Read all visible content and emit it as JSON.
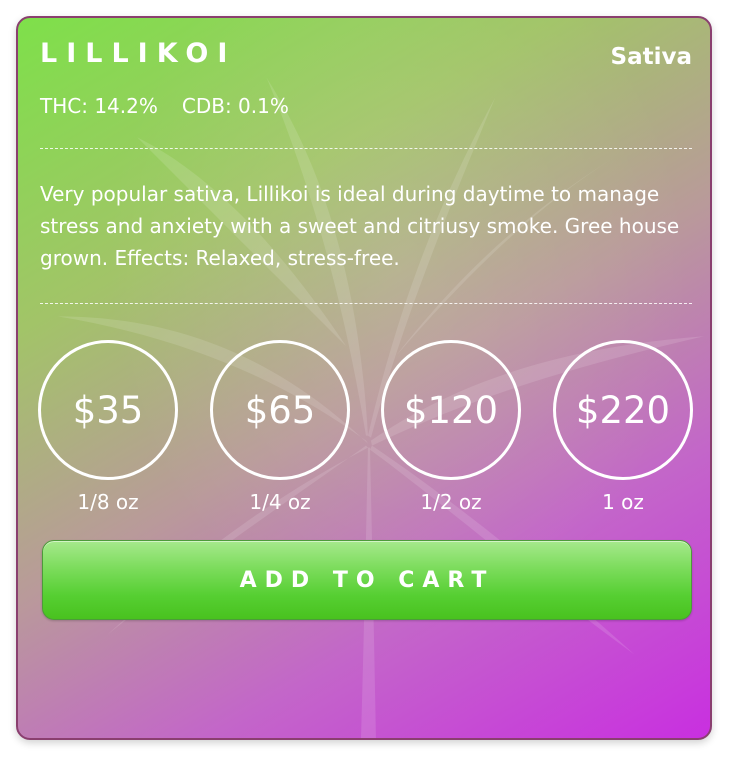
{
  "product": {
    "name": "LILLIKOI",
    "type": "Sativa",
    "thc": "THC: 14.2%",
    "cbd": "CDB: 0.1%",
    "description": "Very popular sativa, Lillikoi is ideal during daytime to manage stress and anxiety with a sweet and citriusy smoke. Gree house grown. Effects: Relaxed, stress-free."
  },
  "pricing": [
    {
      "price": "$35",
      "weight": "1/8 oz"
    },
    {
      "price": "$65",
      "weight": "1/4 oz"
    },
    {
      "price": "$120",
      "weight": "1/2 oz"
    },
    {
      "price": "$220",
      "weight": "1 oz"
    }
  ],
  "actions": {
    "add_to_cart": "ADD TO CART"
  },
  "colors": {
    "gradient_start": "#7ee04a",
    "gradient_end": "#c92fe0",
    "border": "#8a3f6f",
    "button_green": "#56cf32",
    "text": "#ffffff"
  },
  "background_icon": "cannabis-leaf-icon"
}
